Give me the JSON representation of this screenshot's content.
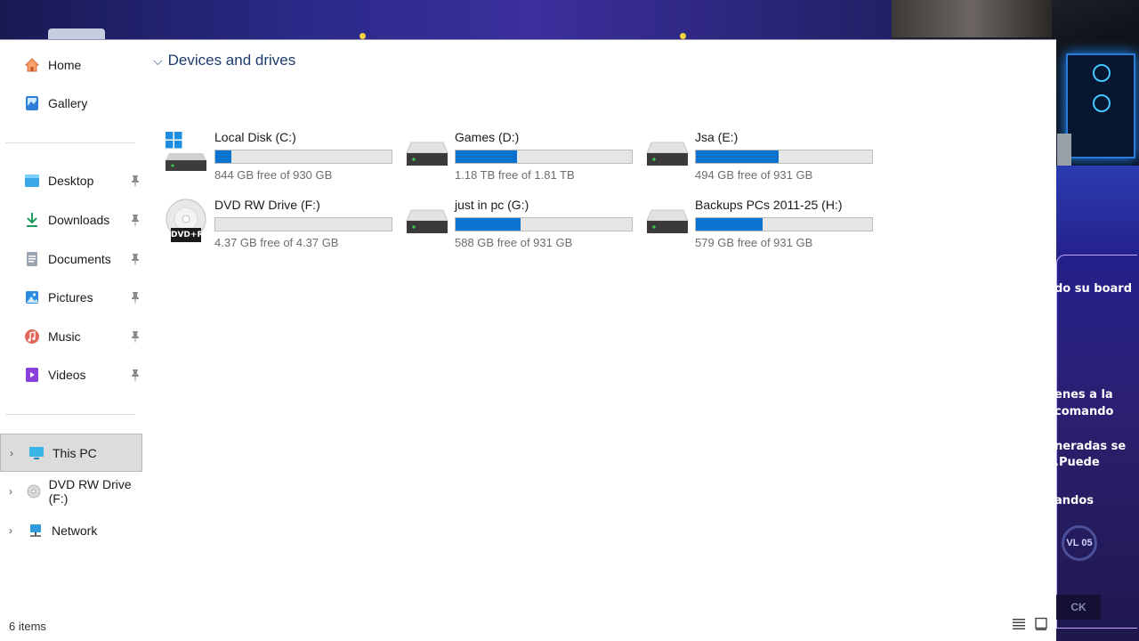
{
  "nav": {
    "home": "Home",
    "gallery": "Gallery",
    "quick_access": [
      {
        "label": "Desktop",
        "icon": "desktop-folder-icon"
      },
      {
        "label": "Downloads",
        "icon": "downloads-arrow-icon"
      },
      {
        "label": "Documents",
        "icon": "documents-icon"
      },
      {
        "label": "Pictures",
        "icon": "pictures-icon"
      },
      {
        "label": "Music",
        "icon": "music-icon"
      },
      {
        "label": "Videos",
        "icon": "videos-icon"
      }
    ],
    "tree": [
      {
        "label": "This PC",
        "selected": true
      },
      {
        "label": "DVD RW Drive (F:)",
        "selected": false
      },
      {
        "label": "Network",
        "selected": false
      }
    ]
  },
  "content": {
    "section_title": "Devices and drives",
    "drives": [
      {
        "name": "Local Disk (C:)",
        "free": "844 GB free of 930 GB",
        "used_fraction": 0.092,
        "type": "system"
      },
      {
        "name": "Games (D:)",
        "free": "1.18 TB free of 1.81 TB",
        "used_fraction": 0.348,
        "type": "hdd"
      },
      {
        "name": "Jsa (E:)",
        "free": "494 GB free of 931 GB",
        "used_fraction": 0.469,
        "type": "hdd"
      },
      {
        "name": "DVD RW Drive (F:)",
        "free": "4.37 GB free of 4.37 GB",
        "used_fraction": 0.0,
        "type": "dvd",
        "disc_label": "DVD+R"
      },
      {
        "name": "just in pc (G:)",
        "free": "588 GB free of 931 GB",
        "used_fraction": 0.368,
        "type": "hdd"
      },
      {
        "name": "Backups PCs 2011-25 (H:)",
        "free": "579 GB free of 931 GB",
        "used_fraction": 0.378,
        "type": "hdd"
      }
    ]
  },
  "status": {
    "items_count": "6 items"
  },
  "overlay": {
    "chat_lines": [
      "do su board",
      "enes a la",
      "comando",
      "neradas se",
      ".Puede",
      "andos"
    ],
    "badge": "VL 05",
    "button": "CK"
  },
  "colors": {
    "bar_fill": "#0a73cf",
    "bar_track": "#e6e6e6",
    "section_title": "#1f3b6e"
  }
}
